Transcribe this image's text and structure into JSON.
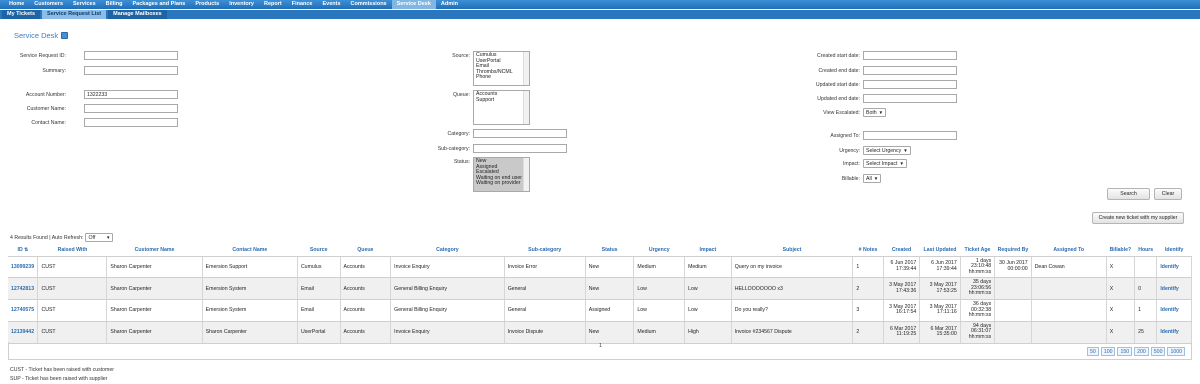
{
  "topnav": [
    "Home",
    "Customers",
    "Services",
    "Billing",
    "Packages and Plans",
    "Products",
    "Inventory",
    "Report",
    "Finance",
    "Events",
    "Commissions",
    "Service Desk",
    "Admin"
  ],
  "topnav_active": 11,
  "subnav": [
    "My Tickets",
    "Service Request List",
    "Manage Mailboxes"
  ],
  "subnav_active": 1,
  "page_title": "Service Desk",
  "form": {
    "left": {
      "service_request_id": {
        "label": "Service Request ID:",
        "value": ""
      },
      "summary": {
        "label": "Summary:",
        "value": ""
      },
      "account_number": {
        "label": "Account Number:",
        "value": "1322233"
      },
      "customer_name": {
        "label": "Customer Name:",
        "value": ""
      },
      "contact_name": {
        "label": "Contact Name:",
        "value": ""
      }
    },
    "middle": {
      "source": {
        "label": "Source:",
        "options": [
          "Cumulus",
          "UserPortal",
          "Email",
          "Thrombs/NCML",
          "Phone"
        ]
      },
      "queue": {
        "label": "Queue:",
        "options": [
          "Accounts",
          "Support"
        ]
      },
      "category": {
        "label": "Category:",
        "value": ""
      },
      "sub_category": {
        "label": "Sub-category:",
        "value": ""
      },
      "status": {
        "label": "Status:",
        "options": [
          "New",
          "Assigned",
          "Escalated",
          "Waiting on end user",
          "Waiting on provider"
        ]
      }
    },
    "right": {
      "created_start": {
        "label": "Created start date:",
        "value": ""
      },
      "created_end": {
        "label": "Created end date:",
        "value": ""
      },
      "updated_start": {
        "label": "Updated start date:",
        "value": ""
      },
      "updated_end": {
        "label": "Updated end date:",
        "value": ""
      },
      "view_escalated": {
        "label": "View Escalated:",
        "value": "Both"
      },
      "assigned_to": {
        "label": "Assigned To:",
        "value": ""
      },
      "urgency": {
        "label": "Urgency:",
        "value": "Select Urgency"
      },
      "impact": {
        "label": "Impact:",
        "value": "Select Impact"
      },
      "billable": {
        "label": "Billable:",
        "value": "All"
      }
    },
    "buttons": {
      "search": "Search",
      "clear": "Clear",
      "create_supplier": "Create new ticket with my supplier"
    }
  },
  "results": {
    "text": "4 Results Found | Auto Refresh:",
    "auto_refresh": "Off"
  },
  "table": {
    "headers": [
      "ID",
      "Raised With",
      "Customer Name",
      "Contact Name",
      "Source",
      "Queue",
      "Category",
      "Sub-category",
      "Status",
      "Urgency",
      "Impact",
      "Subject",
      "# Notes",
      "Created",
      "Last Updated",
      "Ticket Age",
      "Required By",
      "Assigned To",
      "Billable?",
      "Hours",
      "Identify"
    ],
    "rows": [
      {
        "id": "13099239",
        "raised_with": "CUST",
        "customer": "Sharon Carpenter",
        "contact": "Emersion Support",
        "source": "Cumulus",
        "queue": "Accounts",
        "category": "Invoice Enquiry",
        "sub_category": "Invoice Error",
        "status": "New",
        "urgency": "Medium",
        "impact": "Medium",
        "subject": "Query on my invoice",
        "notes": "1",
        "created": "6 Jun 2017 17:39:44",
        "updated": "6 Jun 2017 17:39:44",
        "age": "1 days 23:10:48 hh:mm:ss",
        "required_by": "30 Jun 2017 00:00:00",
        "assigned": "Dean Cowan",
        "billable": "X",
        "hours": "",
        "identify": "Identify"
      },
      {
        "id": "12742813",
        "raised_with": "CUST",
        "customer": "Sharon Carpenter",
        "contact": "Emersion System",
        "source": "Email",
        "queue": "Accounts",
        "category": "General Billing Enquiry",
        "sub_category": "General",
        "status": "New",
        "urgency": "Low",
        "impact": "Low",
        "subject": "HELLOOOOOOO x3",
        "notes": "2",
        "created": "3 May 2017 17:43:36",
        "updated": "3 May 2017 17:53:25",
        "age": "35 days 23:06:56 hh:mm:ss",
        "required_by": "",
        "assigned": "",
        "billable": "X",
        "hours": "0",
        "identify": "Identify"
      },
      {
        "id": "12740575",
        "raised_with": "CUST",
        "customer": "Sharon Carpenter",
        "contact": "Emersion System",
        "source": "Email",
        "queue": "Accounts",
        "category": "General Billing Enquiry",
        "sub_category": "General",
        "status": "Assigned",
        "urgency": "Low",
        "impact": "Low",
        "subject": "Do you really?",
        "notes": "3",
        "created": "3 May 2017 16:17:54",
        "updated": "3 May 2017 17:11:16",
        "age": "36 days 00:32:38 hh:mm:ss",
        "required_by": "",
        "assigned": "",
        "billable": "X",
        "hours": "1",
        "identify": "Identify"
      },
      {
        "id": "12139442",
        "raised_with": "CUST",
        "customer": "Sharon Carpenter",
        "contact": "Sharon Carpenter",
        "source": "UserPortal",
        "queue": "Accounts",
        "category": "Invoice Enquiry",
        "sub_category": "Invoice Dispute",
        "status": "New",
        "urgency": "Medium",
        "impact": "High",
        "subject": "Invoice #234567 Dispute",
        "notes": "2",
        "created": "6 Mar 2017 11:19:25",
        "updated": "6 Mar 2017 15:35:00",
        "age": "94 days 06:31:07 hh:mm:ss",
        "required_by": "",
        "assigned": "",
        "billable": "X",
        "hours": "25",
        "identify": "Identify"
      }
    ],
    "page": "1",
    "page_sizes": [
      "50",
      "100",
      "150",
      "200",
      "500",
      "1000"
    ]
  },
  "legend": [
    "CUST - Ticket has been raised with customer",
    "SUP - Ticket has been raised with supplier"
  ]
}
